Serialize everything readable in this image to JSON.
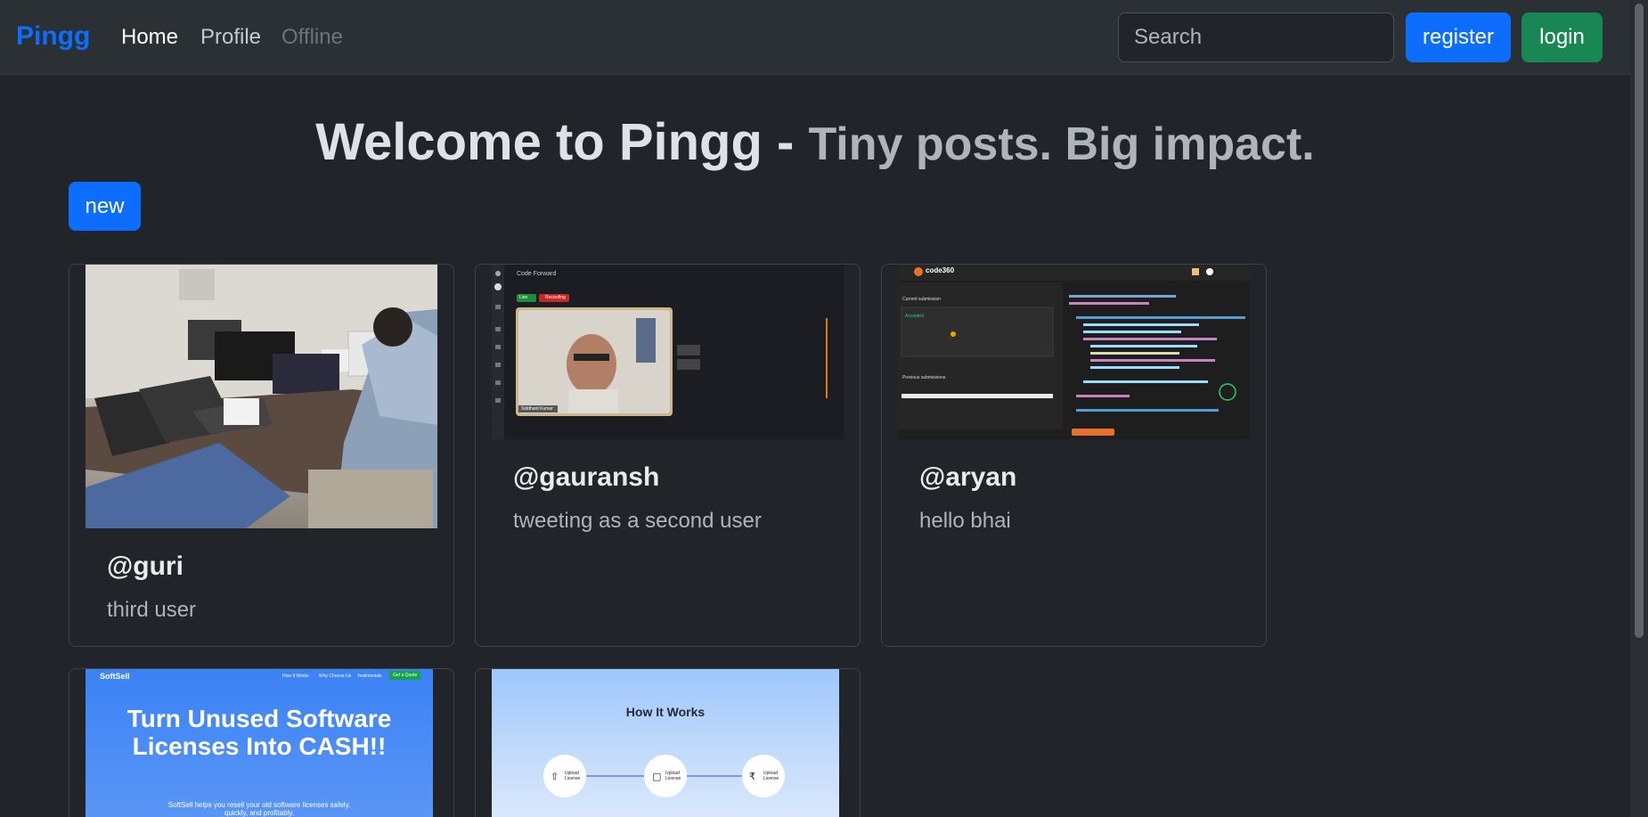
{
  "nav": {
    "brand": "Pingg",
    "links": [
      "Home",
      "Profile",
      "Offline"
    ],
    "search_placeholder": "Search",
    "register_label": "register",
    "login_label": "login"
  },
  "hero": {
    "title": "Welcome to Pingg -",
    "subtitle": "Tiny posts. Big impact."
  },
  "new_label": "new",
  "posts": [
    {
      "user": "@guri",
      "text": "third user"
    },
    {
      "user": "@gauransh",
      "text": "tweeting as a second user",
      "image": {
        "app_title": "Code Forward",
        "badge_live": "Live",
        "badge_recording": "Recording",
        "name_tag": "Siddhant Kumar"
      }
    },
    {
      "user": "@aryan",
      "text": "hello bhai",
      "image": {
        "logo": "code360",
        "section": "Current submission",
        "status": "Accepted",
        "previous": "Previous submissions"
      }
    },
    {
      "user": "",
      "text": "",
      "image": {
        "logo": "SoftSell",
        "nav": [
          "How It Works",
          "Why Choose Us",
          "Testimonials"
        ],
        "cta": "Get a Quote",
        "headline": "Turn Unused Software Licenses Into CASH!!",
        "sub": "SoftSell helps you resell your old software licenses safely, quickly, and profitably."
      }
    },
    {
      "user": "",
      "text": "",
      "image": {
        "heading": "How It Works",
        "steps": [
          "Upload License",
          "Upload License",
          "Upload License"
        ]
      }
    }
  ],
  "colors": {
    "primary": "#0d6efd",
    "success": "#198754",
    "background": "#212529",
    "navbar": "#2b3035"
  }
}
